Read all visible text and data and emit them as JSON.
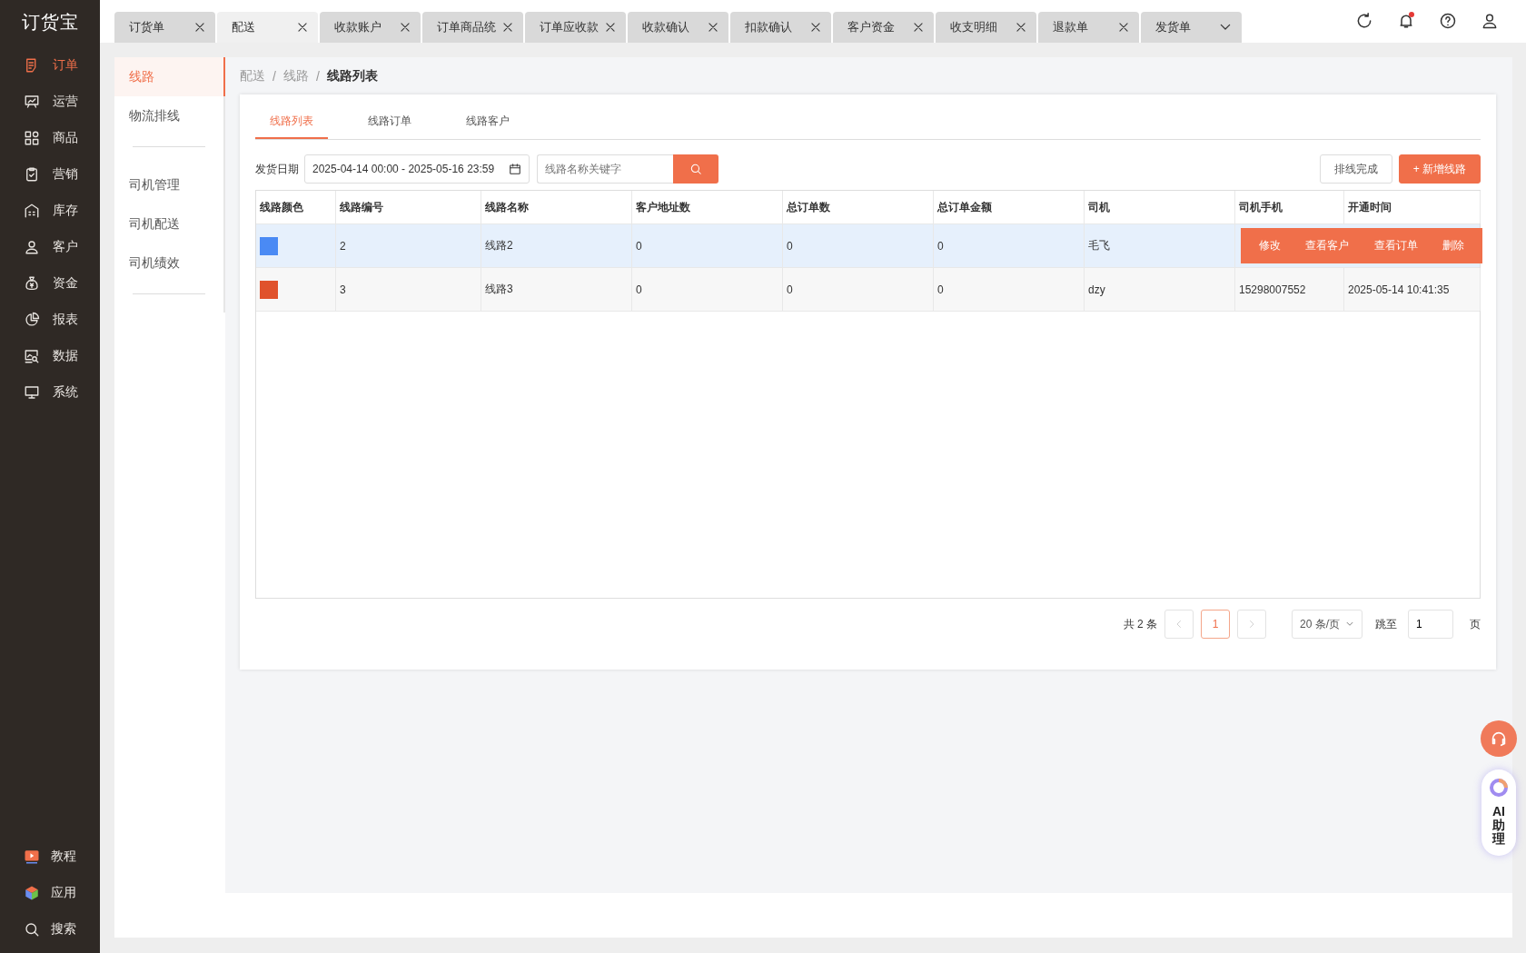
{
  "logo": "订货宝",
  "nav": [
    {
      "label": "订单",
      "kind": "order",
      "selected": true
    },
    {
      "label": "运营",
      "kind": "operations",
      "selected": false
    },
    {
      "label": "商品",
      "kind": "goods",
      "selected": false
    },
    {
      "label": "营销",
      "kind": "marketing",
      "selected": false
    },
    {
      "label": "库存",
      "kind": "stock",
      "selected": false
    },
    {
      "label": "客户",
      "kind": "customer",
      "selected": false
    },
    {
      "label": "资金",
      "kind": "funds",
      "selected": false
    },
    {
      "label": "报表",
      "kind": "report",
      "selected": false
    },
    {
      "label": "数据",
      "kind": "data",
      "selected": false
    },
    {
      "label": "系统",
      "kind": "system",
      "selected": false
    }
  ],
  "nav_bottom": [
    {
      "label": "教程",
      "kind": "tutorial"
    },
    {
      "label": "应用",
      "kind": "apps"
    },
    {
      "label": "搜索",
      "kind": "search"
    }
  ],
  "tabs": [
    {
      "label": "订货单",
      "kind": "closable",
      "selected": false
    },
    {
      "label": "配送",
      "kind": "closable",
      "selected": true
    },
    {
      "label": "收款账户",
      "kind": "closable",
      "selected": false
    },
    {
      "label": "订单商品统",
      "kind": "closable",
      "selected": false
    },
    {
      "label": "订单应收款",
      "kind": "closable",
      "selected": false
    },
    {
      "label": "收款确认",
      "kind": "closable",
      "selected": false
    },
    {
      "label": "扣款确认",
      "kind": "closable",
      "selected": false
    },
    {
      "label": "客户资金",
      "kind": "closable",
      "selected": false
    },
    {
      "label": "收支明细",
      "kind": "closable",
      "selected": false
    },
    {
      "label": "退款单",
      "kind": "closable",
      "selected": false
    },
    {
      "label": "发货单",
      "kind": "dropdown",
      "selected": false
    }
  ],
  "sub_nav": [
    {
      "items": [
        {
          "label": "线路",
          "selected": true
        },
        {
          "label": "物流排线",
          "selected": false
        }
      ]
    },
    {
      "items": [
        {
          "label": "司机管理",
          "selected": false
        },
        {
          "label": "司机配送",
          "selected": false
        },
        {
          "label": "司机绩效",
          "selected": false
        }
      ]
    }
  ],
  "breadcrumb": [
    "配送",
    "线路",
    "线路列表"
  ],
  "breadcrumb_separator": "/",
  "content_tabs": [
    {
      "label": "线路列表",
      "selected": true
    },
    {
      "label": "线路订单",
      "selected": false
    },
    {
      "label": "线路客户",
      "selected": false
    }
  ],
  "filter": {
    "label": "发货日期",
    "date_range": "2025-04-14 00:00 - 2025-05-16 23:59",
    "search_placeholder": "线路名称关键字"
  },
  "buttons": [
    {
      "label": "排线完成",
      "kind": "default"
    },
    {
      "label": "+ 新增线路",
      "kind": "primary"
    }
  ],
  "table": {
    "columns": [
      "线路颜色",
      "线路编号",
      "线路名称",
      "客户地址数",
      "总订单数",
      "总订单金额",
      "司机",
      "司机手机",
      "开通时间"
    ],
    "rows": [
      {
        "color": "#4a8af4",
        "hovered": true,
        "cells": [
          "",
          "2",
          "线路2",
          "0",
          "0",
          "0",
          "毛飞"
        ],
        "actions": [
          "修改",
          "查看客户",
          "查看订单",
          "删除"
        ]
      },
      {
        "color": "#e0522c",
        "hovered": false,
        "cells": [
          "",
          "3",
          "线路3",
          "0",
          "0",
          "0",
          "dzy",
          "15298007552",
          "2025-05-14 10:41:35"
        ]
      }
    ]
  },
  "pagination": {
    "total": "共 2 条",
    "pages": [
      {
        "label": "1",
        "selected": true
      }
    ],
    "page_size": "20 条/页",
    "jump_label": "跳至",
    "jump_value": "1",
    "page_suffix": "页"
  },
  "assistant": {
    "title": "AI",
    "subtitle": "助理"
  }
}
